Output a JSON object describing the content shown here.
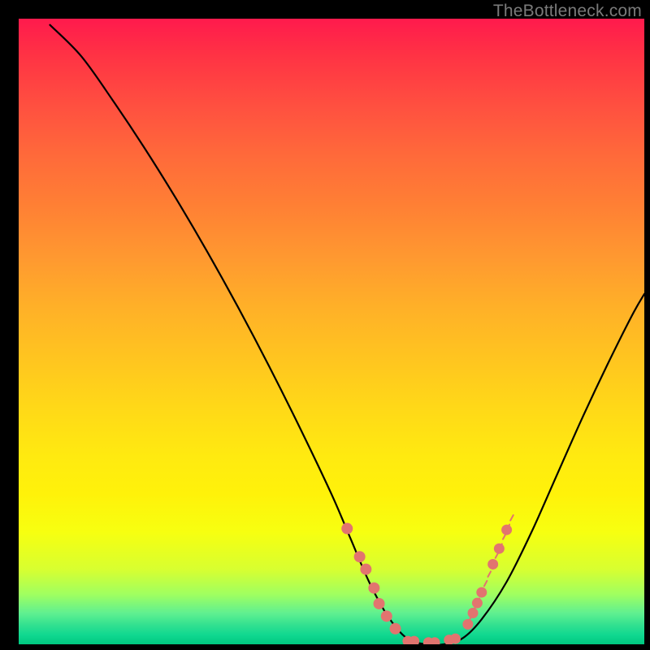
{
  "watermark": "TheBottleneck.com",
  "chart_data": {
    "type": "line",
    "title": "",
    "xlabel": "",
    "ylabel": "",
    "xlim": [
      0,
      100
    ],
    "ylim": [
      0,
      100
    ],
    "series": [
      {
        "name": "curve",
        "x": [
          5,
          10,
          15,
          20,
          25,
          30,
          35,
          40,
          45,
          50,
          53,
          56,
          59,
          62,
          65,
          68,
          71,
          74,
          78,
          82,
          86,
          90,
          94,
          98,
          100
        ],
        "values": [
          99,
          94,
          87,
          79.5,
          71.5,
          63,
          54,
          44.5,
          34.5,
          24,
          17,
          10,
          4.5,
          1,
          0,
          0,
          1,
          4,
          10,
          18,
          27,
          36,
          44.5,
          52.5,
          56
        ]
      },
      {
        "name": "highlight-dots-left",
        "x": [
          52.5,
          54.5,
          55.5,
          56.8,
          57.6,
          58.8,
          60.2
        ],
        "values": [
          18.5,
          14,
          12,
          9,
          6.5,
          4.5,
          2.5
        ]
      },
      {
        "name": "highlight-dots-bottom",
        "x": [
          62.2,
          63.2,
          65.5,
          66.5,
          68.8,
          69.8
        ],
        "values": [
          0.5,
          0.5,
          0.3,
          0.3,
          0.7,
          0.9
        ]
      },
      {
        "name": "highlight-dots-right",
        "x": [
          71.8,
          72.6,
          73.3,
          74.0,
          75.8,
          76.8,
          78.0
        ],
        "values": [
          3.2,
          5.0,
          6.6,
          8.3,
          12.8,
          15.3,
          18.3
        ]
      },
      {
        "name": "tick-marks-right",
        "x": [
          72.0,
          72.6,
          73.2,
          73.8,
          74.4,
          75.0,
          75.6,
          76.2,
          76.8,
          77.4,
          78.0,
          78.6
        ],
        "values": [
          3.8,
          5.2,
          6.5,
          7.9,
          9.3,
          10.8,
          12.3,
          13.8,
          15.2,
          16.8,
          18.3,
          19.8
        ]
      }
    ],
    "grid": false,
    "background_gradient": [
      "#ff1a4d",
      "#ffea10",
      "#00c880"
    ]
  }
}
